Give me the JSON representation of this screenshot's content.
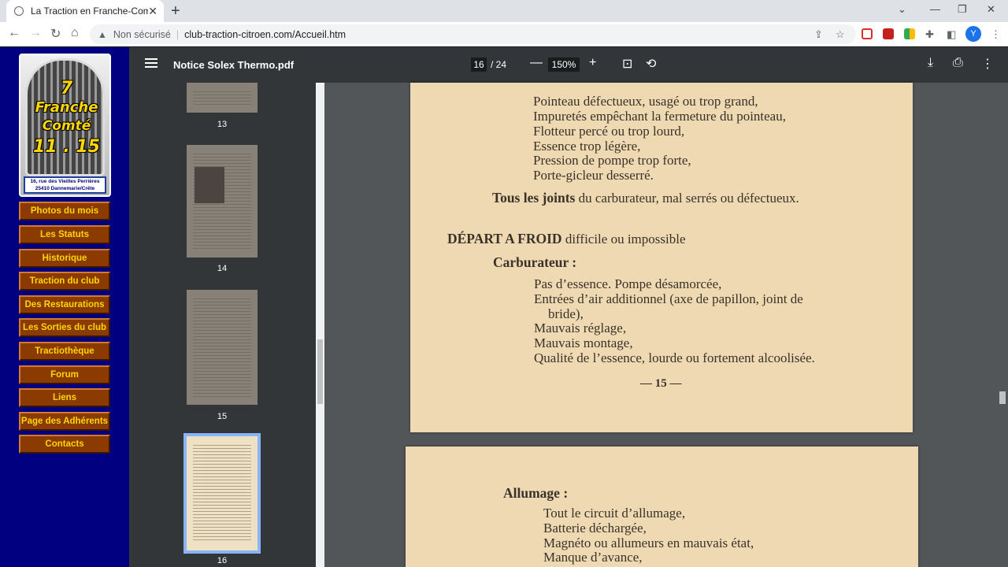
{
  "browser": {
    "tab_title": "La Traction en Franche-Comté",
    "insecure_label": "Non sécurisé",
    "url": "club-traction-citroen.com/Accueil.htm",
    "avatar_letter": "Y"
  },
  "site": {
    "logo": {
      "line1": "7",
      "line2": "Franche",
      "line3": "Comté",
      "line4": "11 . 15",
      "address1": "16, rue des Vieilles Perrières",
      "address2": "25410 Dannemarie/Crête"
    },
    "menu": [
      "Photos du mois",
      "Les Statuts",
      "Historique",
      "Traction du club",
      "Des Restaurations",
      "Les Sorties du club",
      "Tractiothèque",
      "Forum",
      "Liens",
      "Page des Adhérents",
      "Contacts"
    ]
  },
  "pdf": {
    "filename": "Notice Solex Thermo.pdf",
    "current_page": "16",
    "total_pages": "/ 24",
    "zoom": "150%",
    "thumbnails": [
      {
        "label": "13"
      },
      {
        "label": "14"
      },
      {
        "label": "15"
      },
      {
        "label": "16"
      }
    ],
    "page_a_lines": [
      "Pointeau défectueux, usagé ou trop grand,",
      "Impuretés empêchant la fermeture du pointeau,",
      "Flotteur percé ou trop lourd,",
      "Essence trop légère,",
      "Pression de pompe trop forte,",
      "Porte-gicleur desserré."
    ],
    "page_a_joints_bold": "Tous les joints",
    "page_a_joints_rest": "du carburateur, mal serrés ou défectueux.",
    "page_a_heading_bold": "DÉPART A FROID",
    "page_a_heading_rest": "difficile ou impossible",
    "page_a_subheading": "Carburateur :",
    "page_a_items": [
      "Pas d’essence. Pompe désamorcée,",
      "Entrées d’air additionnel (axe de papillon, joint de",
      "bride),",
      "Mauvais réglage,",
      "Mauvais montage,",
      "Qualité de l’essence, lourde ou fortement alcoolisée."
    ],
    "page_a_number": "— 15 —",
    "page_b_subheading": "Allumage :",
    "page_b_items": [
      "Tout le circuit d’allumage,",
      "Batterie déchargée,",
      "Magnéto ou allumeurs en mauvais état,",
      "Manque d’avance,"
    ]
  }
}
